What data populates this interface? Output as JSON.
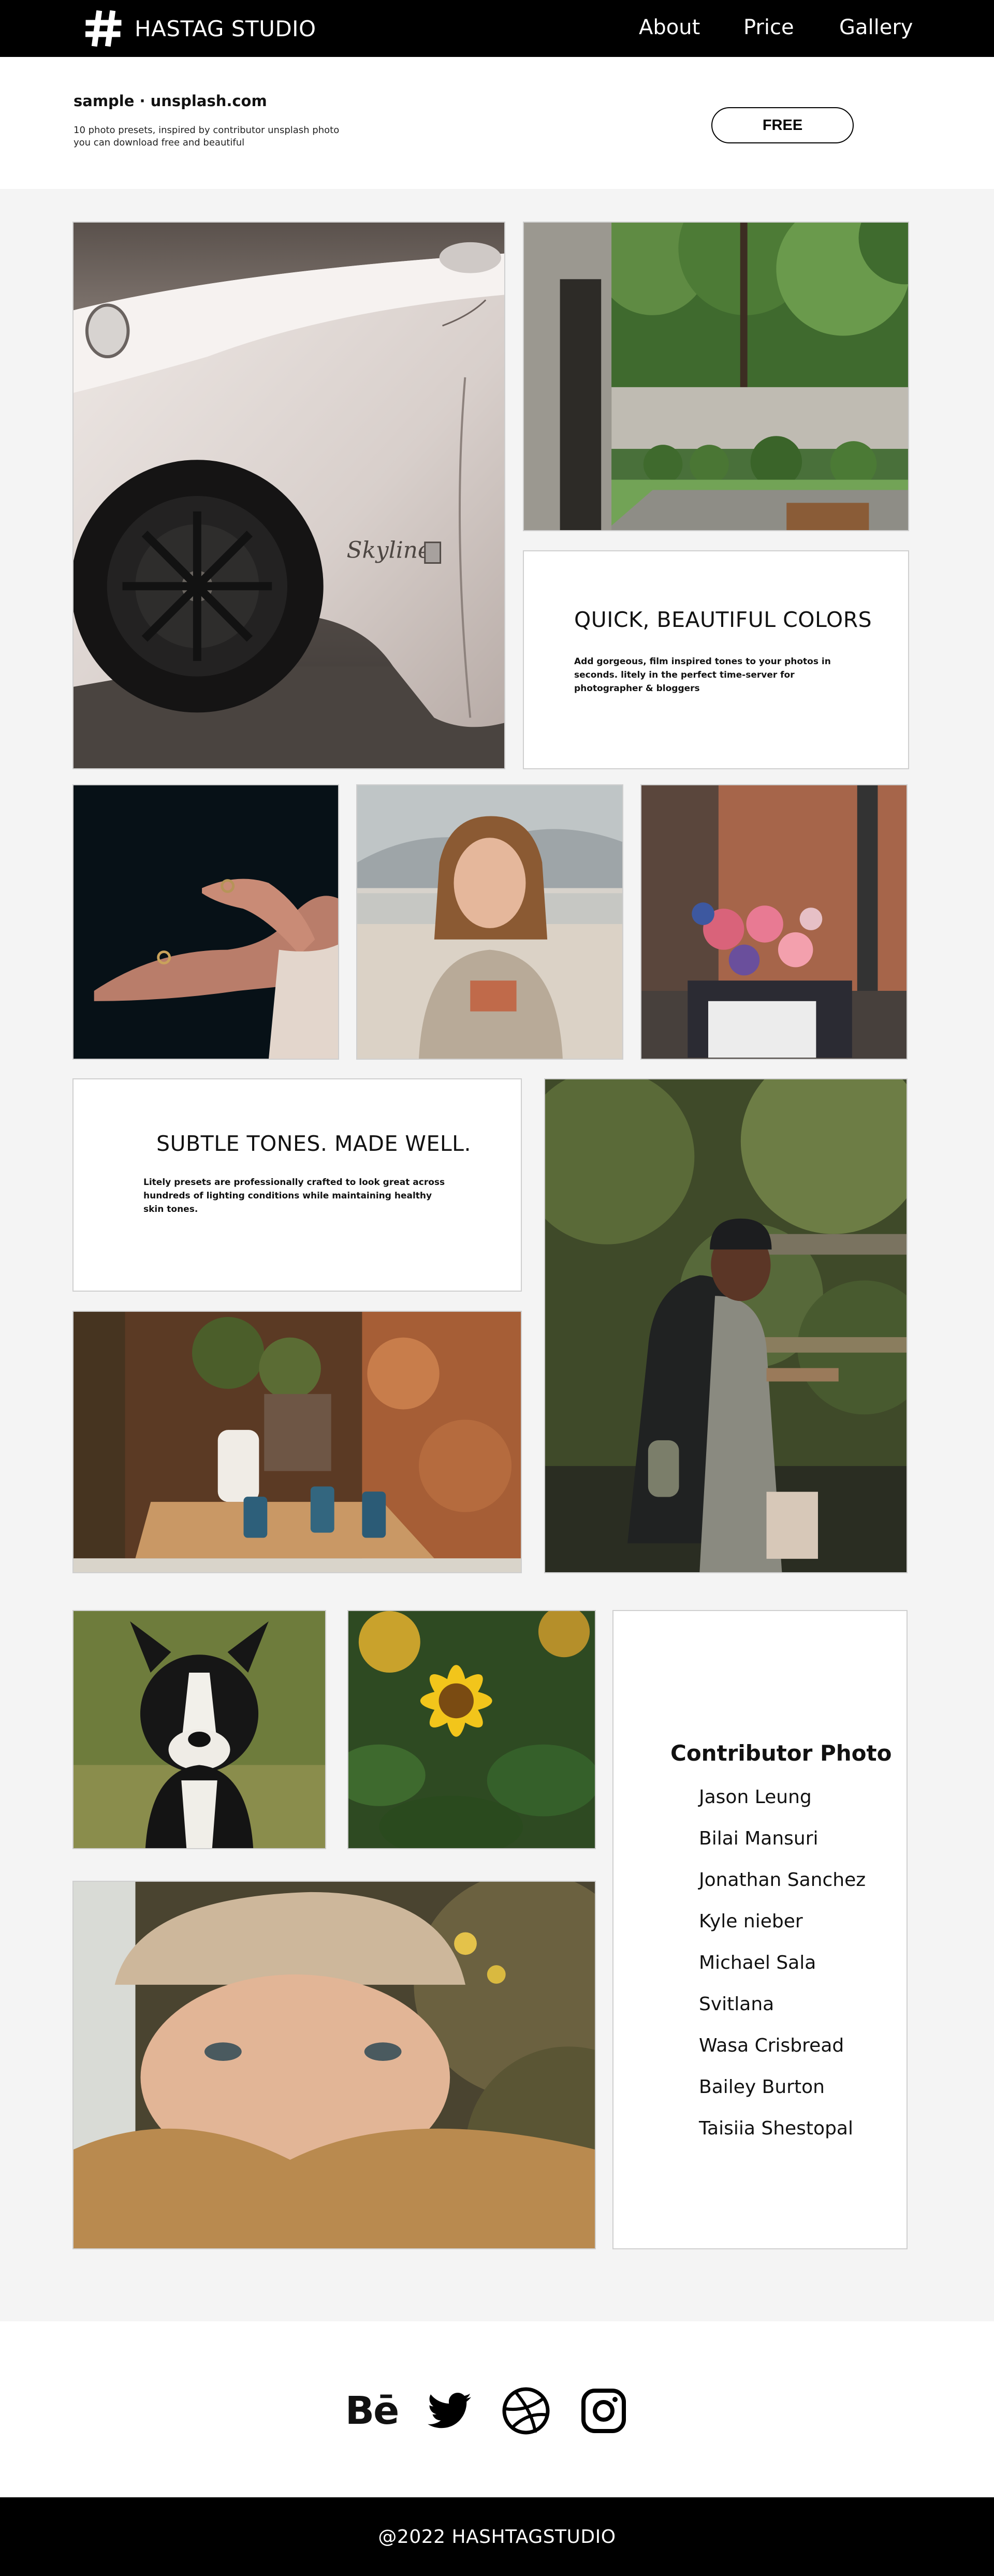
{
  "nav": {
    "brand": "HASTAG STUDIO",
    "links": [
      "About",
      "Price",
      "Gallery"
    ]
  },
  "header": {
    "title": "sample · unsplash.com",
    "description": "10 photo presets, inspired by contributor unsplash photo you can download free and beautiful",
    "button": "FREE"
  },
  "cards": {
    "colors": {
      "heading": "QUICK, BEAUTIFUL COLORS",
      "body": "Add gorgeous, film inspired tones to your photos in seconds. litely in the perfect time-server for photographer & bloggers"
    },
    "tones": {
      "heading": "SUBTLE TONES. MADE WELL.",
      "body": "Litely presets are professionally crafted to look great across hundreds of lighting conditions while maintaining healthy skin tones."
    }
  },
  "contributors": {
    "title": "Contributor Photo",
    "names": [
      "Jason Leung",
      "Bilai Mansuri",
      "Jonathan Sanchez",
      "Kyle nieber",
      "Michael Sala",
      "Svitlana",
      "Wasa Crisbread",
      "Bailey Burton",
      "Taisiia Shestopal"
    ]
  },
  "photos": {
    "car_badge": "Skyline"
  },
  "social": {
    "icons": [
      "behance-icon",
      "twitter-icon",
      "dribbble-icon",
      "instagram-icon"
    ],
    "behance_text": "Bē"
  },
  "footer": {
    "copyright": "@2022 HASHTAGSTUDIO"
  }
}
